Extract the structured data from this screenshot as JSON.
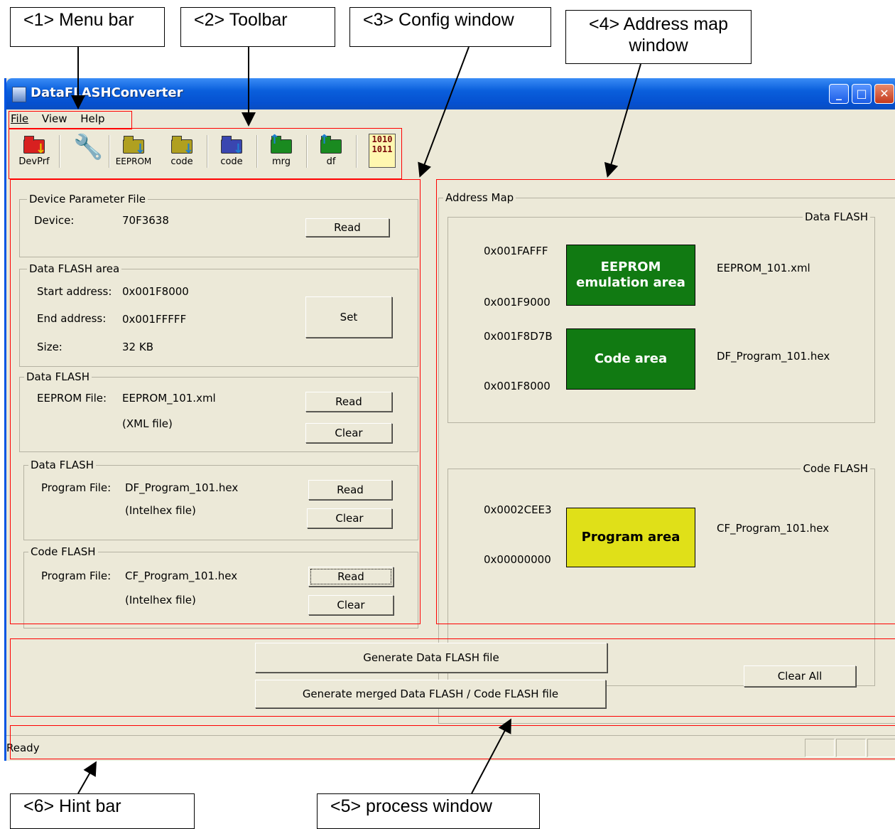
{
  "callouts": {
    "menu_bar": "<1> Menu bar",
    "toolbar": "<2> Toolbar",
    "config_window": "<3> Config window",
    "address_map_window": "<4> Address map window",
    "hint_bar": "<6> Hint bar",
    "process_window": "<5> process window"
  },
  "window": {
    "title": "DataFLASHConverter",
    "minimize": "_",
    "maximize": "□",
    "close": "✕"
  },
  "menu": [
    "File",
    "View",
    "Help"
  ],
  "toolbar": [
    {
      "label": "DevPrf",
      "icon": "folder-down-icon"
    },
    {
      "label": "",
      "icon": "wrench-icon"
    },
    {
      "label": "EEPROM",
      "icon": "folder-down-icon"
    },
    {
      "label": "code",
      "icon": "folder-down-icon"
    },
    {
      "label": "code",
      "icon": "folder-down-icon"
    },
    {
      "label": "mrg",
      "icon": "folder-up-icon"
    },
    {
      "label": "df",
      "icon": "folder-up-icon"
    },
    {
      "label": "",
      "icon": "binary-file-icon",
      "glyph": "1010\n1011"
    }
  ],
  "config": {
    "device_param": {
      "legend": "Device Parameter File",
      "device_label": "Device:",
      "device_value": "70F3638",
      "read": "Read"
    },
    "df_area": {
      "legend": "Data FLASH area",
      "start_label": "Start address:",
      "start_value": "0x001F8000",
      "end_label": "End address:",
      "end_value": "0x001FFFFF",
      "size_label": "Size:",
      "size_value": "32 KB",
      "set": "Set"
    },
    "df_eeprom": {
      "legend": "Data FLASH",
      "file_label": "EEPROM File:",
      "file_value": "EEPROM_101.xml",
      "type": "(XML file)",
      "read": "Read",
      "clear": "Clear"
    },
    "df_program": {
      "legend": "Data FLASH",
      "file_label": "Program File:",
      "file_value": "DF_Program_101.hex",
      "type": "(Intelhex file)",
      "read": "Read",
      "clear": "Clear"
    },
    "cf_program": {
      "legend": "Code FLASH",
      "file_label": "Program File:",
      "file_value": "CF_Program_101.hex",
      "type": "(Intelhex file)",
      "read": "Read",
      "clear": "Clear"
    }
  },
  "address_map": {
    "legend": "Address Map",
    "data_flash": {
      "legend": "Data FLASH",
      "eeprom_top": "0x001FAFFF",
      "eeprom_bottom": "0x001F9000",
      "eeprom_area": "EEPROM\nemulation area",
      "eeprom_file": "EEPROM_101.xml",
      "eeprom_color": "#117a12",
      "code_top": "0x001F8D7B",
      "code_bottom": "0x001F8000",
      "code_area": "Code area",
      "code_file": "DF_Program_101.hex",
      "code_color": "#117a12"
    },
    "code_flash": {
      "legend": "Code FLASH",
      "top": "0x0002CEE3",
      "bottom": "0x00000000",
      "area": "Program area",
      "file": "CF_Program_101.hex",
      "color": "#e0e018"
    }
  },
  "process": {
    "generate_df": "Generate Data FLASH file",
    "generate_merged": "Generate merged Data FLASH / Code FLASH file",
    "clear_all": "Clear All"
  },
  "status": {
    "text": "Ready"
  }
}
